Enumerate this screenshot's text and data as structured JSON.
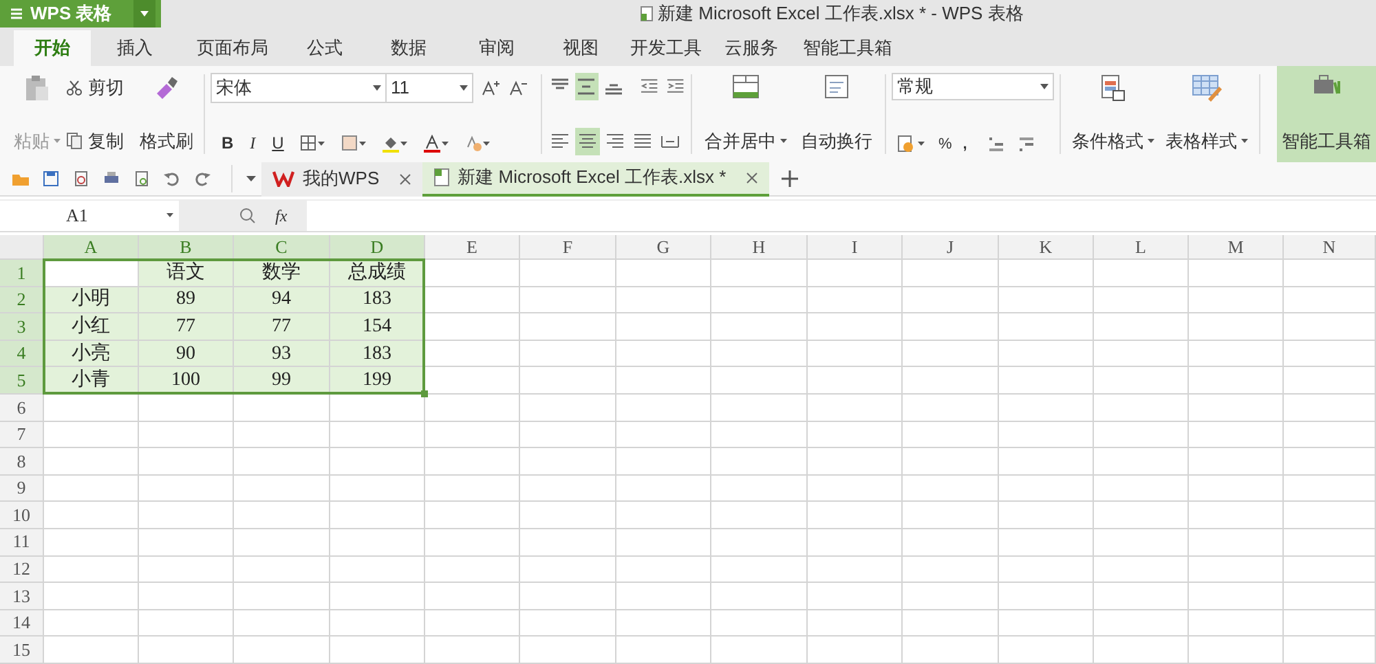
{
  "app_button": {
    "label": "WPS 表格"
  },
  "window_title": "新建 Microsoft Excel 工作表.xlsx * - WPS 表格",
  "menu_tabs": [
    {
      "label": "开始",
      "selected": true
    },
    {
      "label": "插入",
      "selected": false
    },
    {
      "label": "页面布局",
      "selected": false
    },
    {
      "label": "公式",
      "selected": false
    },
    {
      "label": "数据",
      "selected": false
    },
    {
      "label": "审阅",
      "selected": false
    },
    {
      "label": "视图",
      "selected": false
    },
    {
      "label": "开发工具",
      "selected": false
    },
    {
      "label": "云服务",
      "selected": false
    },
    {
      "label": "智能工具箱",
      "selected": false
    }
  ],
  "ribbon": {
    "paste": "粘贴",
    "cut": "剪切",
    "copy": "复制",
    "format_painter": "格式刷",
    "font_name": "宋体",
    "font_size": "11",
    "bold": "B",
    "italic": "I",
    "underline": "U",
    "vertical_align": [
      {
        "selected": false
      },
      {
        "selected": true
      },
      {
        "selected": false
      }
    ],
    "horizontal_align": [
      {
        "selected": false
      },
      {
        "selected": true
      },
      {
        "selected": false
      },
      {
        "selected": false
      },
      {
        "selected": false
      }
    ],
    "merge": "合并居中",
    "wrap": "自动换行",
    "number_format": "常规",
    "percent": "%",
    "comma": ",",
    "conditional_format": "条件格式",
    "table_style": "表格样式",
    "smart_toolbox": {
      "label": "智能工具箱",
      "selected": true
    }
  },
  "doc_tabs": [
    {
      "label": "我的WPS",
      "selected": false
    },
    {
      "label": "新建 Microsoft Excel 工作表.xlsx *",
      "selected": true
    }
  ],
  "name_box": "A1",
  "fx": "fx",
  "sheet": {
    "columns": [
      {
        "label": "A",
        "selected": true
      },
      {
        "label": "B",
        "selected": true
      },
      {
        "label": "C",
        "selected": true
      },
      {
        "label": "D",
        "selected": true
      },
      {
        "label": "E",
        "selected": false
      },
      {
        "label": "F",
        "selected": false
      },
      {
        "label": "G",
        "selected": false
      },
      {
        "label": "H",
        "selected": false
      },
      {
        "label": "I",
        "selected": false
      },
      {
        "label": "J",
        "selected": false
      },
      {
        "label": "K",
        "selected": false
      },
      {
        "label": "L",
        "selected": false
      },
      {
        "label": "M",
        "selected": false
      },
      {
        "label": "N",
        "selected": false
      }
    ],
    "rows": [
      {
        "label": "1",
        "selected": true,
        "cells": [
          {
            "active": true
          },
          {
            "text": "语文"
          },
          {
            "text": "数学"
          },
          {
            "text": "总成绩"
          }
        ]
      },
      {
        "label": "2",
        "selected": true,
        "cells": [
          {
            "text": "小明"
          },
          {
            "text": "89"
          },
          {
            "text": "94"
          },
          {
            "text": "183"
          }
        ]
      },
      {
        "label": "3",
        "selected": true,
        "cells": [
          {
            "text": "小红"
          },
          {
            "text": "77"
          },
          {
            "text": "77"
          },
          {
            "text": "154"
          }
        ]
      },
      {
        "label": "4",
        "selected": true,
        "cells": [
          {
            "text": "小亮"
          },
          {
            "text": "90"
          },
          {
            "text": "93"
          },
          {
            "text": "183"
          }
        ]
      },
      {
        "label": "5",
        "selected": true,
        "cells": [
          {
            "text": "小青"
          },
          {
            "text": "100"
          },
          {
            "text": "99"
          },
          {
            "text": "199"
          }
        ]
      },
      {
        "label": "6",
        "selected": false
      },
      {
        "label": "7",
        "selected": false
      },
      {
        "label": "8",
        "selected": false
      },
      {
        "label": "9",
        "selected": false
      },
      {
        "label": "10",
        "selected": false
      },
      {
        "label": "11",
        "selected": false
      },
      {
        "label": "12",
        "selected": false
      },
      {
        "label": "13",
        "selected": false
      },
      {
        "label": "14",
        "selected": false
      },
      {
        "label": "15",
        "selected": false
      }
    ]
  }
}
